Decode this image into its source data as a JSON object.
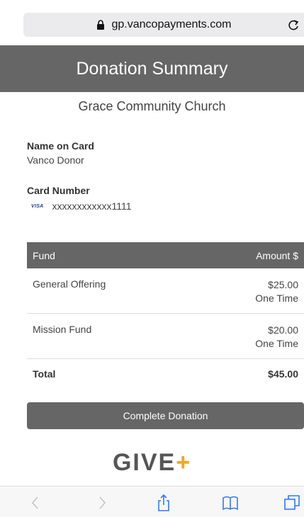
{
  "browser": {
    "url": "gp.vancopayments.com"
  },
  "header": {
    "title": "Donation Summary"
  },
  "organization": "Grace Community Church",
  "card": {
    "name_label": "Name on Card",
    "name_value": "Vanco Donor",
    "number_label": "Card Number",
    "brand": "VISA",
    "number_value": "xxxxxxxxxxxx1111"
  },
  "table": {
    "headers": [
      "Fund",
      "Amount $"
    ],
    "rows": [
      {
        "fund": "General Offering",
        "amount": "$25.00",
        "frequency": "One Time"
      },
      {
        "fund": "Mission Fund",
        "amount": "$20.00",
        "frequency": "One Time"
      }
    ],
    "total_label": "Total",
    "total_value": "$45.00"
  },
  "actions": {
    "complete_label": "Complete Donation"
  },
  "logo": {
    "text": "GIVE",
    "plus": "+"
  },
  "colors": {
    "header_bg": "#666666",
    "accent": "#f5a623"
  }
}
